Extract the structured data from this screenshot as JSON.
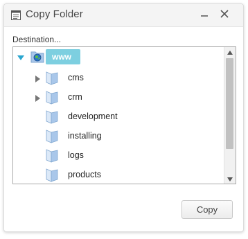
{
  "window": {
    "title": "Copy Folder",
    "icon": "document-list-icon",
    "controls": [
      "minimize-icon",
      "close-icon"
    ]
  },
  "destination_label": "Destination...",
  "tree": {
    "root": {
      "label": "www",
      "icon": "globe-folder-icon",
      "expanded": true,
      "selected": true
    },
    "items": [
      {
        "label": "cms",
        "expandable": true
      },
      {
        "label": "crm",
        "expandable": true
      },
      {
        "label": "development",
        "expandable": false
      },
      {
        "label": "installing",
        "expandable": false
      },
      {
        "label": "logs",
        "expandable": false
      },
      {
        "label": "products",
        "expandable": false
      }
    ]
  },
  "actions": {
    "copy_label": "Copy"
  },
  "colors": {
    "selection": "#7dcfe0",
    "folder": "#a9c7ea",
    "expander_expanded": "#2aa6cf",
    "expander_collapsed": "#777777"
  }
}
